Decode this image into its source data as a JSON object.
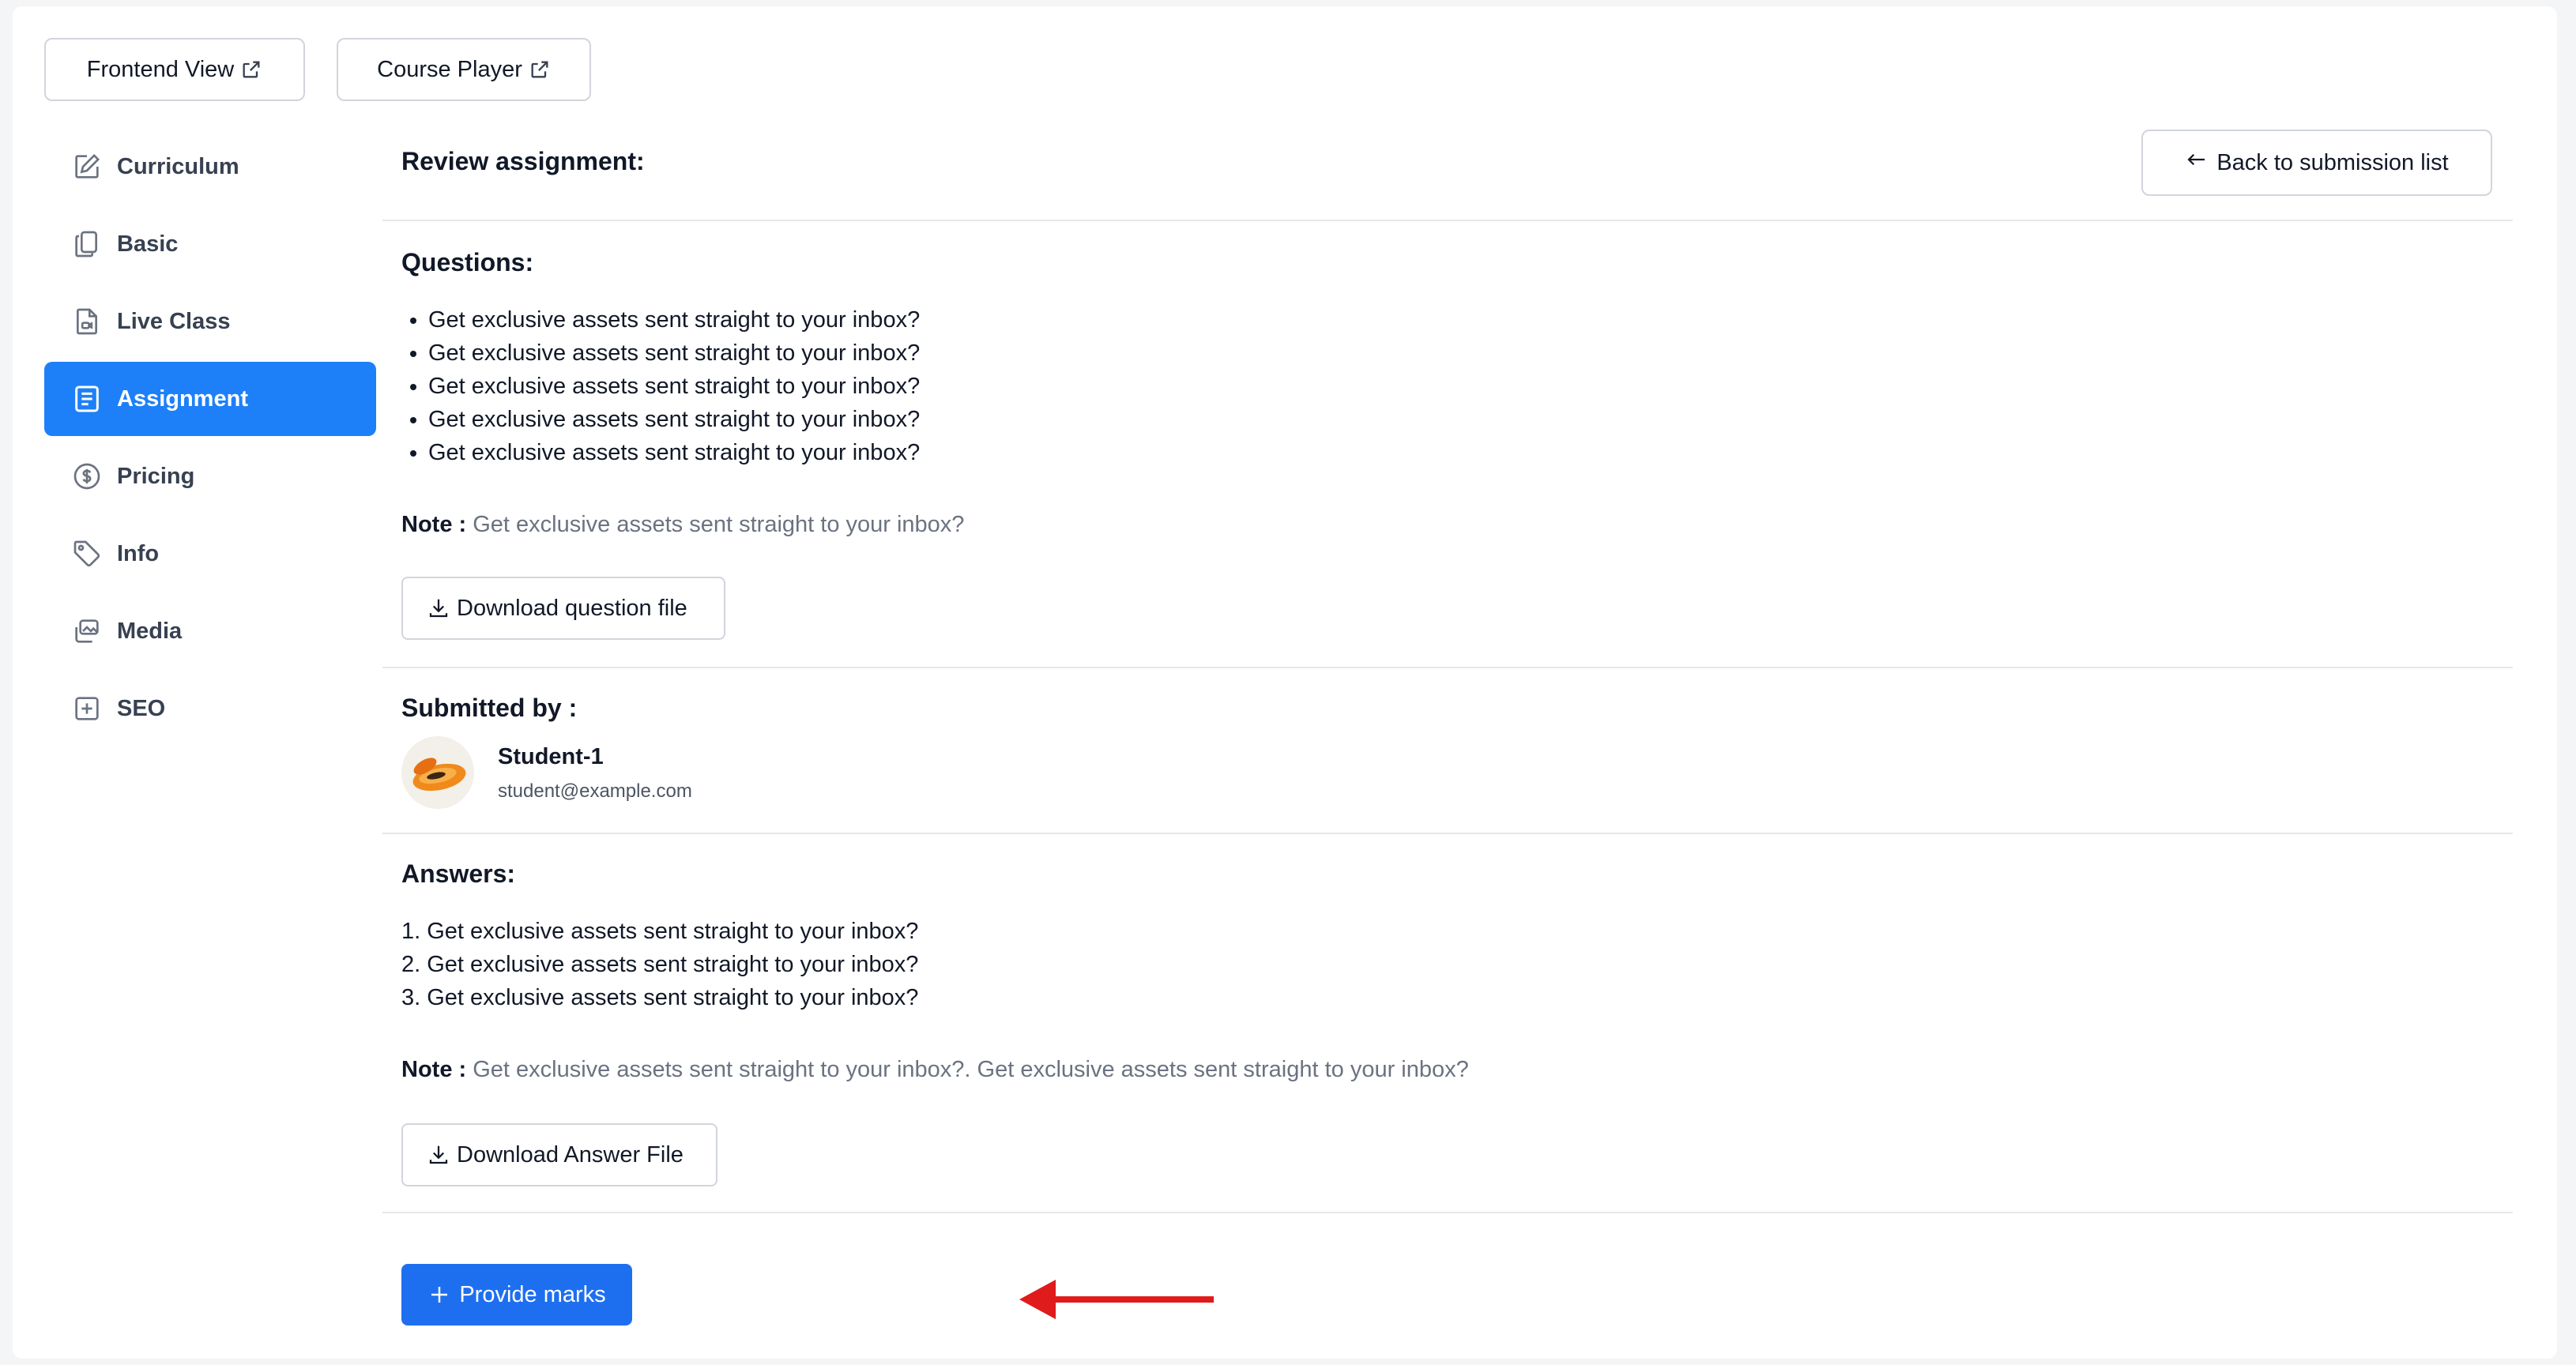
{
  "top_buttons": {
    "frontend_view": "Frontend View",
    "course_player": "Course Player"
  },
  "sidebar": {
    "items": [
      {
        "label": "Curriculum",
        "icon": "edit-icon"
      },
      {
        "label": "Basic",
        "icon": "copy-icon"
      },
      {
        "label": "Live Class",
        "icon": "live-class-doc-icon"
      },
      {
        "label": "Assignment",
        "icon": "assignment-icon",
        "active": true
      },
      {
        "label": "Pricing",
        "icon": "dollar-icon"
      },
      {
        "label": "Info",
        "icon": "tag-icon"
      },
      {
        "label": "Media",
        "icon": "media-icon"
      },
      {
        "label": "SEO",
        "icon": "seo-icon"
      }
    ]
  },
  "header": {
    "title": "Review assignment:",
    "back_label": "Back to submission list"
  },
  "questions": {
    "title": "Questions:",
    "items": [
      "Get exclusive assets sent straight to your inbox?",
      "Get exclusive assets sent straight to your inbox?",
      "Get exclusive assets sent straight to your inbox?",
      "Get exclusive assets sent straight to your inbox?",
      "Get exclusive assets sent straight to your inbox?"
    ],
    "note_label": "Note :",
    "note_text": "Get exclusive assets sent straight to your inbox?",
    "download_label": "Download question file"
  },
  "submitted": {
    "title": "Submitted by :",
    "name": "Student-1",
    "email": "student@example.com"
  },
  "answers": {
    "title": "Answers:",
    "items": [
      "1. Get exclusive assets sent straight to your inbox?",
      "2. Get exclusive assets sent straight to your inbox?",
      "3. Get exclusive assets sent straight to your inbox?"
    ],
    "note_label": "Note :",
    "note_text": "Get exclusive assets sent straight to your inbox?. Get exclusive assets sent straight to your inbox?",
    "download_label": "Download Answer File"
  },
  "actions": {
    "provide_marks": "Provide marks"
  },
  "colors": {
    "accent": "#1e80f8",
    "primary_button": "#1e6ff0",
    "annotation_arrow": "#e01b1b"
  }
}
